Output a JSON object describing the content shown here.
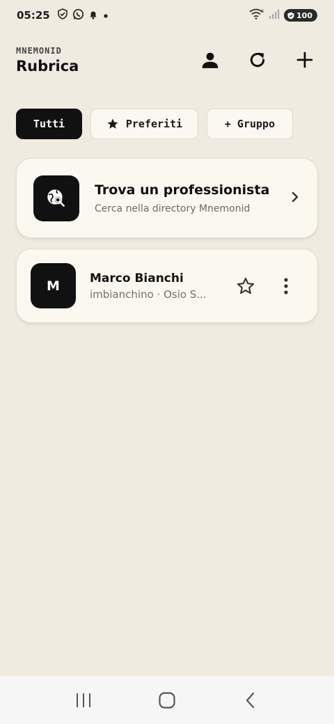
{
  "status": {
    "time": "05:25",
    "battery": "100",
    "icons": [
      "shield-check-icon",
      "whatsapp-icon",
      "bell-icon",
      "dot-icon",
      "wifi-icon",
      "signal-icon"
    ]
  },
  "header": {
    "brand": "MNEMONID",
    "title": "Rubrica",
    "actions": [
      "person-icon",
      "refresh-icon",
      "plus-icon"
    ]
  },
  "filters": {
    "all": "Tutti",
    "favorites": "Preferiti",
    "group": "+ Gruppo",
    "active": "Tutti"
  },
  "finder": {
    "title": "Trova un professionista",
    "subtitle": "Cerca nella directory Mnemonid"
  },
  "contacts": [
    {
      "initial": "M",
      "name": "Marco Bianchi",
      "subtitle": "imbianchino · Osio S...",
      "favorite": false
    }
  ],
  "nav": [
    "recents-icon",
    "home-icon",
    "back-icon"
  ],
  "colors": {
    "background": "#f0ebe1",
    "card": "#fbf8f0",
    "accent": "#111111",
    "muted": "#6a6a6a"
  }
}
